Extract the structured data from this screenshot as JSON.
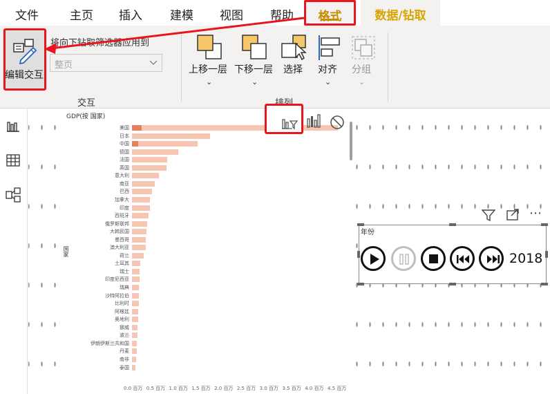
{
  "menu": {
    "file": "文件",
    "home": "主页",
    "insert": "插入",
    "modeling": "建模",
    "view": "视图",
    "help": "帮助",
    "format": "格式",
    "data_drill": "数据/钻取"
  },
  "ribbon": {
    "edit_interactions": "编辑交互",
    "apply_drill_label": "将向下钻取筛选器应用到",
    "apply_drill_value": "整页",
    "interactions_group": "交互",
    "bring_forward": "上移一层",
    "send_backward": "下移一层",
    "select": "选择",
    "align": "对齐",
    "group": "分组",
    "arrange_group": "排列"
  },
  "rail": {
    "report_icon": "report-view-icon",
    "data_icon": "data-view-icon",
    "model_icon": "model-view-icon"
  },
  "chart_data": {
    "type": "bar",
    "title": "GDP(按 国家)",
    "ylabel": "国家",
    "xlabel": "",
    "categories": [
      "美国",
      "日本",
      "中国",
      "德国",
      "法国",
      "英国",
      "意大利",
      "南亚",
      "巴西",
      "加拿大",
      "印度",
      "西班牙",
      "俄罗斯联邦",
      "大韩民国",
      "墨西哥",
      "澳大利亚",
      "荷兰",
      "土耳其",
      "瑞士",
      "印度尼西亚",
      "瑞典",
      "沙特阿拉伯",
      "比利时",
      "阿根廷",
      "奥地利",
      "挪威",
      "波兰",
      "伊朗伊斯兰共和国",
      "丹麦",
      "南非",
      "泰国"
    ],
    "values": [
      4.55,
      1.72,
      1.45,
      1.02,
      0.78,
      0.76,
      0.6,
      0.5,
      0.44,
      0.4,
      0.4,
      0.37,
      0.33,
      0.32,
      0.31,
      0.3,
      0.26,
      0.18,
      0.17,
      0.17,
      0.16,
      0.15,
      0.15,
      0.13,
      0.13,
      0.12,
      0.12,
      0.11,
      0.11,
      0.09,
      0.08
    ],
    "highlight": [
      0.22,
      0,
      0.13
    ],
    "xticks": [
      "0.0 百万",
      "0.5 百万",
      "1.0 百万",
      "1.5 百万",
      "2.0 百万",
      "2.5 百万",
      "3.0 百万",
      "3.5 百万",
      "4.0 百万",
      "4.5 百万"
    ],
    "xlim": [
      0,
      4.5
    ],
    "colors": {
      "bar": "#f6c6b3",
      "highlight": "#e9805d"
    }
  },
  "slicer": {
    "title": "年份",
    "year": "2018"
  },
  "colors": {
    "accent_red": "#e8141e",
    "format_tab": "#c58e00",
    "data_tab": "#d9a300"
  }
}
